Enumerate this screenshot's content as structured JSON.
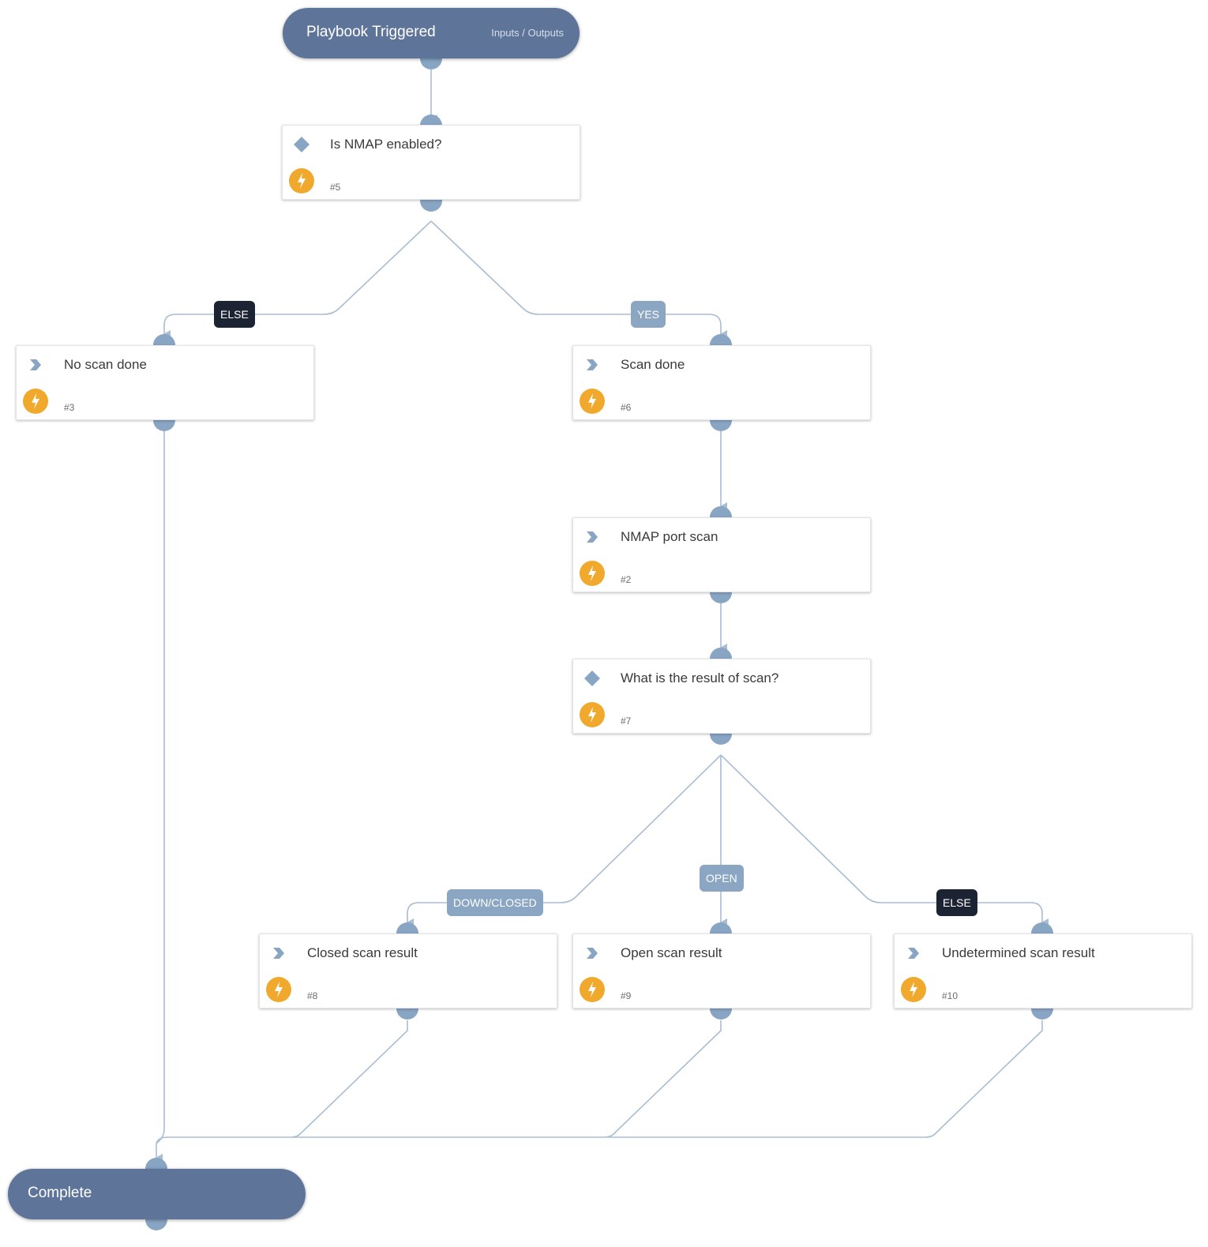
{
  "colors": {
    "pill": "#5f7499",
    "port": "#89a5c4",
    "wire": "#a9bdd3",
    "bolt": "#f0a92c",
    "label_dark": "#1c2333",
    "label_light": "#8aa6c3"
  },
  "start": {
    "title": "Playbook Triggered",
    "link": "Inputs / Outputs"
  },
  "end": {
    "title": "Complete"
  },
  "tasks": [
    {
      "id": "5",
      "title": "Is NMAP enabled?",
      "number": "#5",
      "type": "condition"
    },
    {
      "id": "3",
      "title": "No scan done",
      "number": "#3",
      "type": "standard"
    },
    {
      "id": "6",
      "title": "Scan done",
      "number": "#6",
      "type": "standard"
    },
    {
      "id": "2",
      "title": "NMAP port scan",
      "number": "#2",
      "type": "standard"
    },
    {
      "id": "7",
      "title": "What is the result of scan?",
      "number": "#7",
      "type": "condition"
    },
    {
      "id": "8",
      "title": "Closed scan result",
      "number": "#8",
      "type": "standard"
    },
    {
      "id": "9",
      "title": "Open scan result",
      "number": "#9",
      "type": "standard"
    },
    {
      "id": "10",
      "title": "Undetermined scan result",
      "number": "#10",
      "type": "standard"
    }
  ],
  "branch_labels": {
    "t5_else": "ELSE",
    "t5_yes": "YES",
    "t7_down": "DOWN/CLOSED",
    "t7_open": "OPEN",
    "t7_else": "ELSE"
  },
  "icons": {
    "condition": "diamond-icon",
    "standard": "chevron-right-icon",
    "automation": "lightning-bolt-icon"
  }
}
